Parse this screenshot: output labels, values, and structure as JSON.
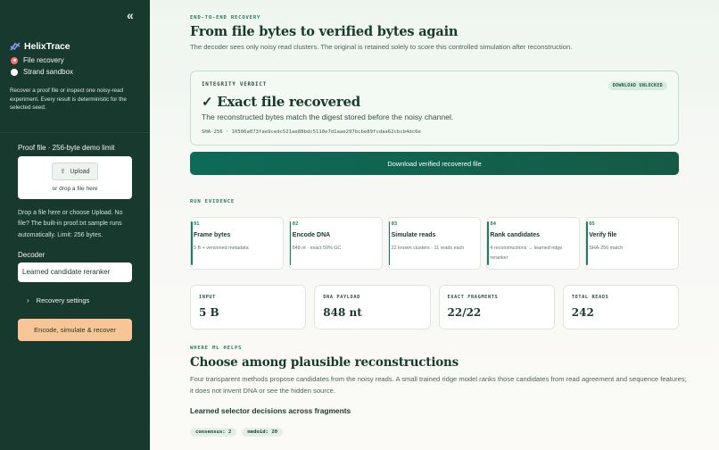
{
  "sidebar": {
    "collapse_label": "«",
    "brand": "HelixTrace",
    "modes": [
      {
        "label": "File recovery",
        "selected": true
      },
      {
        "label": "Strand sandbox",
        "selected": false
      }
    ],
    "description": "Recover a proof file or inspect one noisy-read experiment. Every result is deterministic for the selected seed.",
    "proof_label": "Proof file · 256-byte demo limit",
    "upload_label": "Upload",
    "drop_text": "or drop a file here",
    "help_text": "Drop a file here or choose Upload. No file? The built-in proof.txt sample runs automatically. Limit: 256 bytes.",
    "decoder_label": "Decoder",
    "decoder_value": "Learned candidate reranker",
    "recovery_settings": "Recovery settings",
    "run_button": "Encode, simulate & recover"
  },
  "header": {
    "eyebrow": "END-TO-END RECOVERY",
    "title": "From file bytes to verified bytes again",
    "subtitle": "The decoder sees only noisy read clusters. The original is retained solely to score this controlled simulation after reconstruction."
  },
  "verdict": {
    "tag": "INTEGRITY VERDICT",
    "badge": "DOWNLOAD UNLOCKED",
    "title": "✓ Exact file recovered",
    "description": "The reconstructed bytes match the digest stored before the noisy channel.",
    "hash": "SHA-256 · 10506a073fae9cedc521ae88bdc5110e7d1aae297bcbe89fcdaa62cbcb4dc6e"
  },
  "download_button": "Download verified recovered file",
  "evidence": {
    "eyebrow": "RUN EVIDENCE",
    "steps": [
      {
        "num": "01",
        "title": "Frame bytes",
        "detail": "5 B + versioned metadata"
      },
      {
        "num": "02",
        "title": "Encode DNA",
        "detail": "848 nt · exact 50% GC"
      },
      {
        "num": "03",
        "title": "Simulate reads",
        "detail": "22 known clusters · 11 reads each"
      },
      {
        "num": "04",
        "title": "Rank candidates",
        "detail": "4 reconstructions → learned ridge reranker"
      },
      {
        "num": "05",
        "title": "Verify file",
        "detail": "SHA-256 match"
      }
    ]
  },
  "metrics": [
    {
      "label": "INPUT",
      "value": "5 B"
    },
    {
      "label": "DNA PAYLOAD",
      "value": "848 nt"
    },
    {
      "label": "EXACT FRAGMENTS",
      "value": "22/22"
    },
    {
      "label": "TOTAL READS",
      "value": "242"
    }
  ],
  "ml": {
    "eyebrow": "WHERE ML HELPS",
    "title": "Choose among plausible reconstructions",
    "description": "Four transparent methods propose candidates from the noisy reads. A small trained ridge model ranks those candidates from read agreement and sequence features; it does not invent DNA or see the hidden source.",
    "subheading": "Learned selector decisions across fragments",
    "chips": [
      "consensus: 2",
      "medoid: 20"
    ]
  }
}
